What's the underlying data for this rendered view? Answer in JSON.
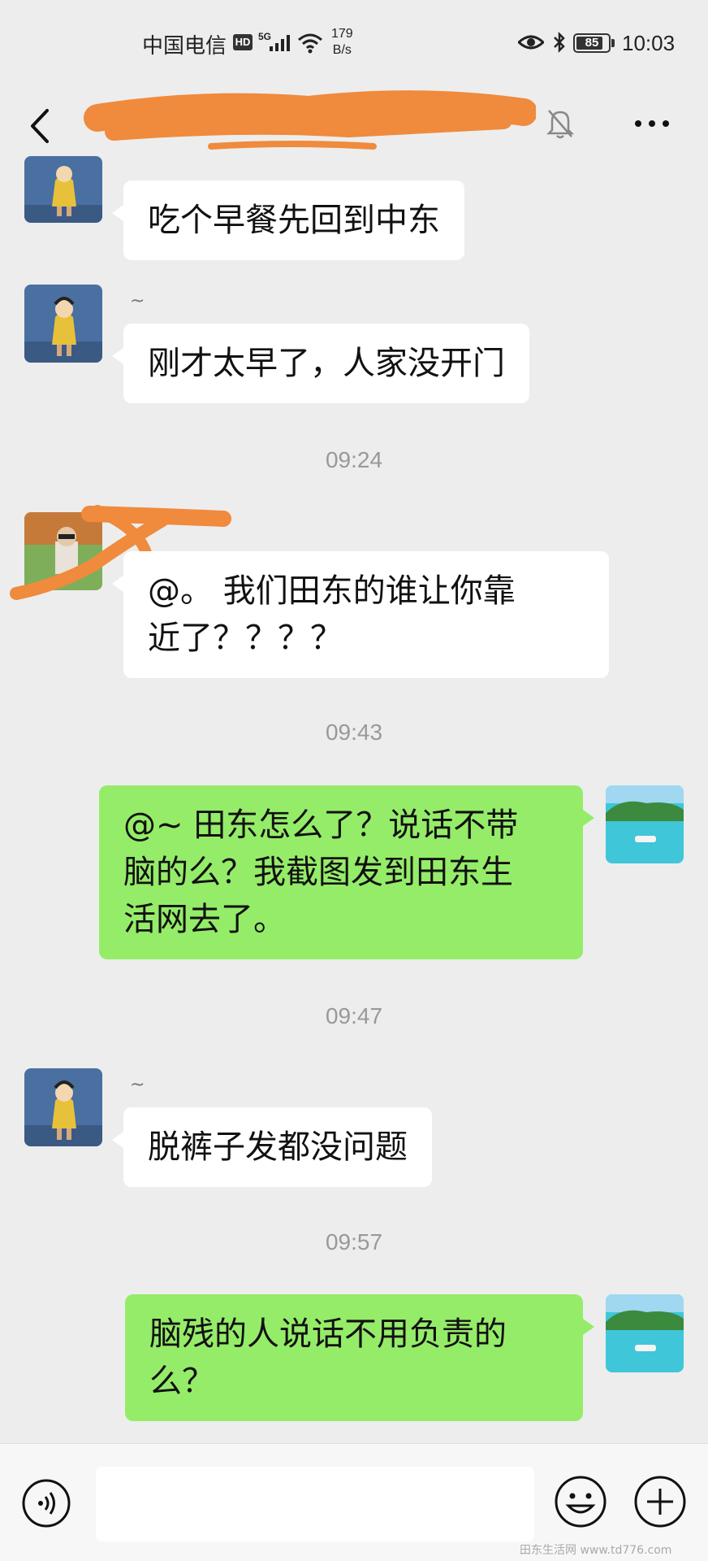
{
  "status_bar": {
    "carrier": "中国电信",
    "hd_badge": "HD",
    "network": "5G",
    "speed_value": "179",
    "speed_unit": "B/s",
    "battery": "85",
    "battery_level": 0.85,
    "time": "10:03"
  },
  "nav": {
    "back_icon": "chevron-left-icon",
    "mute_icon": "bell-off-icon",
    "more_icon": "more-dots-icon"
  },
  "messages": [
    {
      "direction": "in",
      "avatar": "cartoon-child-yellow-raincoat",
      "text": "吃个早餐先回到中东"
    },
    {
      "direction": "in",
      "sender": "~",
      "avatar": "cartoon-child-yellow-raincoat",
      "text": "刚才太早了，人家没开门"
    },
    {
      "type": "time",
      "text": "09:24"
    },
    {
      "direction": "in",
      "avatar": "photo-child-sunglasses",
      "line1": "@。 我们田东的谁让你靠",
      "line2": "近了？？？？"
    },
    {
      "type": "time",
      "text": "09:43"
    },
    {
      "direction": "out",
      "avatar": "island-boat-photo",
      "line1": "@~ 田东怎么了？说话不带",
      "line2": "脑的么？我截图发到田东生",
      "line3": "活网去了。"
    },
    {
      "type": "time",
      "text": "09:47"
    },
    {
      "direction": "in",
      "sender": "~",
      "avatar": "cartoon-child-yellow-raincoat",
      "text": "脱裤子发都没问题"
    },
    {
      "type": "time",
      "text": "09:57"
    },
    {
      "direction": "out",
      "avatar": "island-boat-photo",
      "line1": "脑残的人说话不用负责的",
      "line2": "么？"
    }
  ],
  "input_bar": {
    "voice_icon": "voice-icon",
    "emoji_icon": "emoji-icon",
    "plus_icon": "plus-icon",
    "message_value": ""
  },
  "watermark": "田东生活网 www.td776.com",
  "colors": {
    "background": "#ededed",
    "bubble_in": "#ffffff",
    "bubble_out": "#95ec69",
    "redaction": "#f08a3c"
  }
}
